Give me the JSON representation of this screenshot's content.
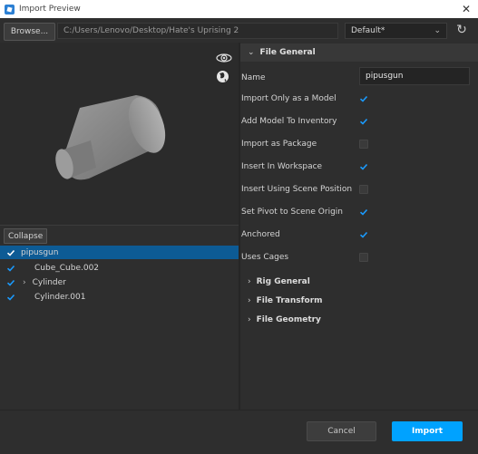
{
  "window": {
    "title": "Import Preview"
  },
  "toolbar": {
    "browse_label": "Browse...",
    "path": "C:/Users/Lenovo/Desktop/Hate's Uprising 2",
    "preset_value": "Default*"
  },
  "tree": {
    "collapse_label": "Collapse",
    "items": [
      {
        "label": "pipusgun",
        "checked": true,
        "selected": true
      },
      {
        "label": "Cube_Cube.002",
        "checked": true
      },
      {
        "label": "Cylinder",
        "checked": true,
        "expandable": true
      },
      {
        "label": "Cylinder.001",
        "checked": true
      }
    ]
  },
  "props": {
    "section_title": "File General",
    "name_label": "Name",
    "name_value": "pipusgun",
    "rows": [
      {
        "label": "Import Only as a Model",
        "checked": true
      },
      {
        "label": "Add Model To Inventory",
        "checked": true
      },
      {
        "label": "Import as Package",
        "checked": false
      },
      {
        "label": "Insert In Workspace",
        "checked": true
      },
      {
        "label": "Insert Using Scene Position",
        "checked": false
      },
      {
        "label": "Set Pivot to Scene Origin",
        "checked": true
      },
      {
        "label": "Anchored",
        "checked": true
      },
      {
        "label": "Uses Cages",
        "checked": false
      }
    ],
    "collapsed_sections": [
      "Rig General",
      "File Transform",
      "File Geometry"
    ]
  },
  "footer": {
    "cancel_label": "Cancel",
    "import_label": "Import"
  },
  "colors": {
    "accent": "#00a2ff",
    "selection": "#0d5b95",
    "check": "#1a9bff"
  }
}
